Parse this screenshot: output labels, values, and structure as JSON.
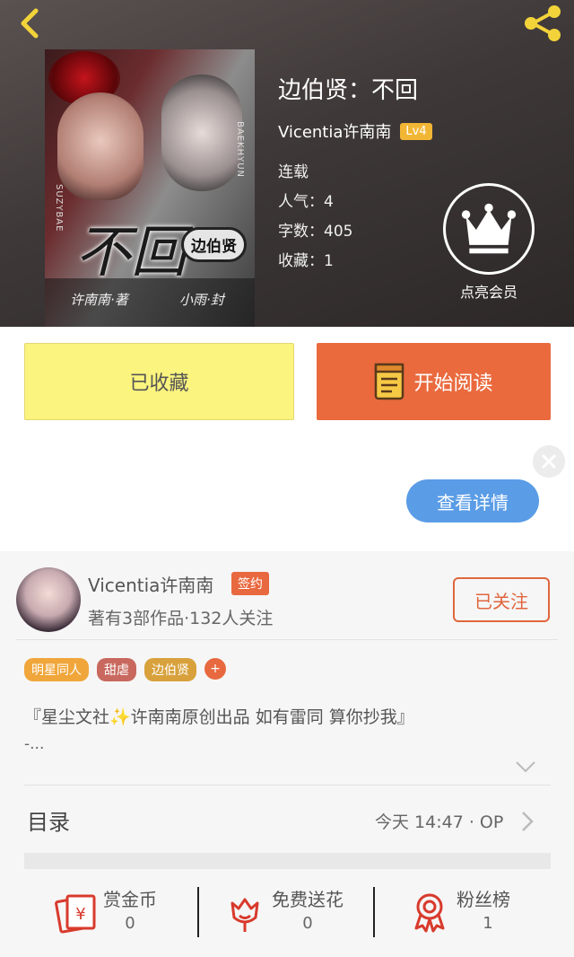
{
  "header": {
    "book_title": "边伯贤：不回",
    "author": "Vicentia许南南",
    "level": "Lv4",
    "status": "连载",
    "popularity": "人气：4",
    "word_count": "字数：405",
    "favorites": "收藏：1",
    "vip_label": "点亮会员"
  },
  "cover": {
    "title_art": "不回",
    "badge": "边伯贤",
    "left_vertical": "SUZYBAE",
    "right_vertical": "BAEKHYUN",
    "sig_left": "许南南·著",
    "sig_right": "小雨·封"
  },
  "actions": {
    "fav_label": "已收藏",
    "read_label": "开始阅读"
  },
  "ad": {
    "details_label": "查看详情"
  },
  "author_card": {
    "name": "Vicentia许南南",
    "signed_badge": "签约",
    "subtitle": "著有3部作品·132人关注",
    "follow_label": "已关注",
    "tags": [
      {
        "label": "明星同人",
        "color": "#f0a63a"
      },
      {
        "label": "甜虐",
        "color": "#c8685e"
      },
      {
        "label": "边伯贤",
        "color": "#d8a13c"
      },
      {
        "label": "+",
        "color": "#e8693f"
      }
    ],
    "intro": "『星尘文社✨许南南原创出品 如有雷同 算你抄我』",
    "intro_more": "-..."
  },
  "toc": {
    "title": "目录",
    "updated": "今天 14:47 · OP"
  },
  "bottom": {
    "reward_label": "赏金币",
    "reward_count": "0",
    "flower_label": "免费送花",
    "flower_count": "0",
    "fans_label": "粉丝榜",
    "fans_count": "1"
  },
  "colors": {
    "accent": "#e8693f",
    "favorite_button": "#fbf47e",
    "details_button": "#5a9ce6",
    "level_badge": "#f2b635"
  }
}
